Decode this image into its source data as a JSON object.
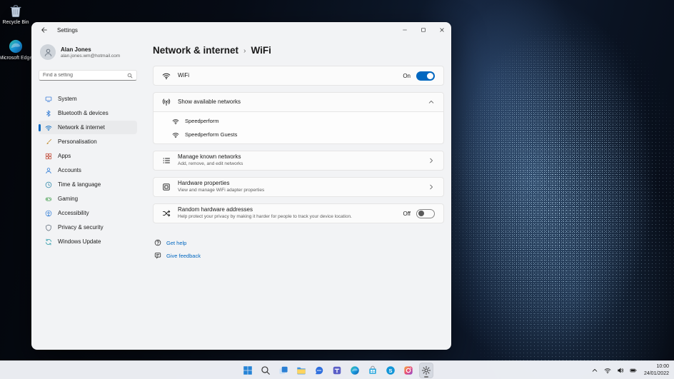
{
  "colors": {
    "accent": "#0067c0"
  },
  "desktop": {
    "icons": [
      {
        "id": "recycle-bin",
        "label": "Recycle Bin",
        "icon": "recycle-bin"
      },
      {
        "id": "microsoft-edge",
        "label": "Microsoft Edge",
        "icon": "edge"
      }
    ]
  },
  "settings_window": {
    "titlebar": {
      "title": "Settings"
    },
    "sidebar": {
      "user": {
        "name": "Alan Jones",
        "email": "alan.jones.wm@hotmail.com"
      },
      "search_placeholder": "Find a setting",
      "items": [
        {
          "id": "system",
          "label": "System",
          "icon": "system",
          "icon_color": "#3b7dd8",
          "selected": false
        },
        {
          "id": "bluetooth-devices",
          "label": "Bluetooth & devices",
          "icon": "bluetooth",
          "icon_color": "#1f6fd0",
          "selected": false
        },
        {
          "id": "network-internet",
          "label": "Network & internet",
          "icon": "wifi",
          "icon_color": "#0067c0",
          "selected": true
        },
        {
          "id": "personalisation",
          "label": "Personalisation",
          "icon": "brush",
          "icon_color": "#c08b2d",
          "selected": false
        },
        {
          "id": "apps",
          "label": "Apps",
          "icon": "apps",
          "icon_color": "#c14a36",
          "selected": false
        },
        {
          "id": "accounts",
          "label": "Accounts",
          "icon": "person",
          "icon_color": "#2f7cd6",
          "selected": false
        },
        {
          "id": "time-language",
          "label": "Time & language",
          "icon": "clock",
          "icon_color": "#2b86a8",
          "selected": false
        },
        {
          "id": "gaming",
          "label": "Gaming",
          "icon": "controller",
          "icon_color": "#3f9e49",
          "selected": false
        },
        {
          "id": "accessibility",
          "label": "Accessibility",
          "icon": "accessibility",
          "icon_color": "#2f7cd6",
          "selected": false
        },
        {
          "id": "privacy-security",
          "label": "Privacy & security",
          "icon": "shield",
          "icon_color": "#5d6a78",
          "selected": false
        },
        {
          "id": "windows-update",
          "label": "Windows Update",
          "icon": "update",
          "icon_color": "#2b9ba8",
          "selected": false
        }
      ]
    },
    "main": {
      "breadcrumb": {
        "parent": "Network & internet",
        "separator": "›",
        "current": "WiFi"
      },
      "wifi_card": {
        "label": "WiFi",
        "state": "On"
      },
      "available_networks": {
        "label": "Show available networks",
        "networks": [
          {
            "name": "Speedperform"
          },
          {
            "name": "Speedperform Guests"
          }
        ]
      },
      "manage_known_networks": {
        "title": "Manage known networks",
        "subtitle": "Add, remove, and edit networks"
      },
      "hardware_properties": {
        "title": "Hardware properties",
        "subtitle": "View and manage WiFi adapter properties"
      },
      "random_hardware_addresses": {
        "title": "Random hardware addresses",
        "subtitle": "Help protect your privacy by making it harder for people to track your device location.",
        "state": "Off"
      },
      "links": [
        {
          "id": "get-help",
          "label": "Get help",
          "icon": "help"
        },
        {
          "id": "give-feedback",
          "label": "Give feedback",
          "icon": "feedback"
        }
      ]
    }
  },
  "taskbar": {
    "items": [
      {
        "id": "start",
        "icon": "start",
        "active": false
      },
      {
        "id": "search",
        "icon": "tb-search",
        "active": false
      },
      {
        "id": "task-view",
        "icon": "task-view",
        "active": false
      },
      {
        "id": "file-explorer",
        "icon": "folder",
        "active": false
      },
      {
        "id": "chat",
        "icon": "chat",
        "active": false
      },
      {
        "id": "teams",
        "icon": "teams",
        "active": false
      },
      {
        "id": "edge",
        "icon": "edge",
        "active": false
      },
      {
        "id": "store",
        "icon": "store",
        "active": false
      },
      {
        "id": "skype",
        "icon": "skype",
        "active": false
      },
      {
        "id": "photos",
        "icon": "photos",
        "active": false
      },
      {
        "id": "settings",
        "icon": "gear",
        "active": true
      }
    ],
    "tray": {
      "icons": [
        {
          "id": "hidden-icons",
          "icon": "chevron-up"
        },
        {
          "id": "network",
          "icon": "wifi"
        },
        {
          "id": "volume",
          "icon": "volume"
        },
        {
          "id": "battery",
          "icon": "battery"
        }
      ],
      "time": "10:00",
      "date": "24/01/2022"
    }
  }
}
